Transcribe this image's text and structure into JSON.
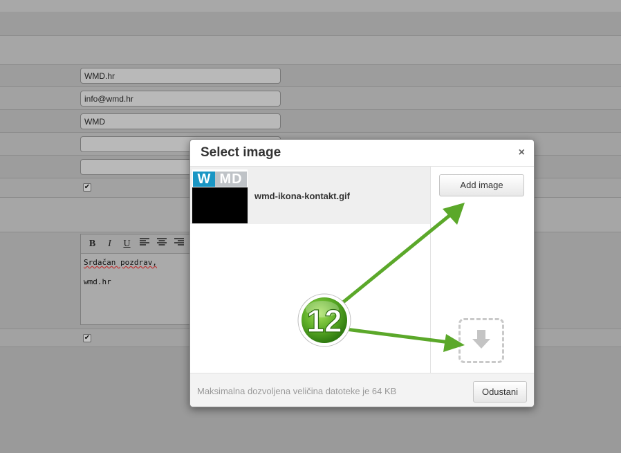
{
  "background_form": {
    "fields": [
      {
        "value": "WMD.hr"
      },
      {
        "value": "info@wmd.hr"
      },
      {
        "value": "WMD"
      },
      {
        "value": ""
      },
      {
        "value": ""
      }
    ],
    "checkbox_mark": "✔",
    "editor": {
      "toolbar": [
        "B",
        "I",
        "U"
      ],
      "lines": [
        "Srdačan pozdrav,",
        "",
        "wmd.hr"
      ]
    }
  },
  "modal": {
    "title": "Select image",
    "close_symbol": "×",
    "files": [
      {
        "name": "wmd-ikona-kontakt.gif",
        "thumb_text_left": "W",
        "thumb_text_right": "MD"
      }
    ],
    "add_button_label": "Add image",
    "footer_note": "Maksimalna dozvoljena veličina datoteke je 64 KB",
    "cancel_button_label": "Odustani",
    "drop_zone_icon": "download-arrow-icon"
  },
  "annotation": {
    "step_number": "12",
    "color": "#5ba82a"
  }
}
